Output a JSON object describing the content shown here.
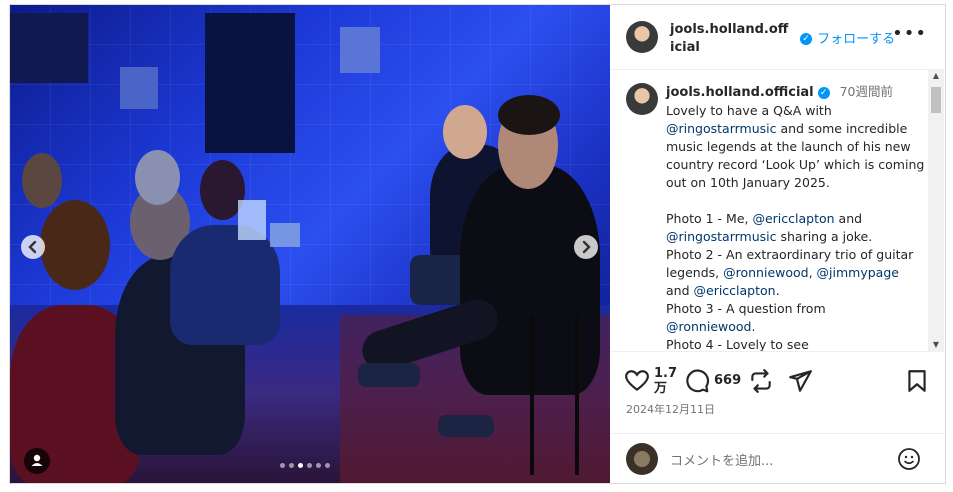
{
  "header": {
    "username": "jools.holland.official",
    "follow_label": "フォローする",
    "more_icon": "more-horizontal-icon"
  },
  "caption": {
    "username": "jools.holland.official",
    "time_ago": "70週間前",
    "line1_a": "Lovely to have a Q&A with",
    "mention_ringo": "@ringostarrmusic",
    "line1_b": " and some incredible music legends at the launch of his new country record ‘Look Up’ which is coming out on 10th January 2025.",
    "p1_a": "Photo 1 - Me, ",
    "p1_mention1": "@ericclapton",
    "p1_b": " and ",
    "p1_mention2": "@ringostarrmusic",
    "p1_c": " sharing a joke.",
    "p2_a": "Photo 2 - An extraordinary trio of guitar legends, ",
    "p2_mention1": "@ronniewood",
    "p2_sep": ", ",
    "p2_mention2": "@jimmypage",
    "p2_b": " and ",
    "p2_mention3": "@ericclapton",
    "p2_c": ".",
    "p3_a": "Photo 3 - A question from ",
    "p3_mention": "@ronniewood",
    "p3_b": ".",
    "p4": "Photo 4 - Lovely to see"
  },
  "actions": {
    "like_count_1": "1.7",
    "like_count_2": "万",
    "comment_count": "669",
    "date": "2024年12月11日",
    "icons": [
      "heart-icon",
      "comment-icon",
      "repost-icon",
      "share-icon",
      "bookmark-icon"
    ]
  },
  "comment": {
    "placeholder": "コメントを追加...",
    "emoji_icon": "emoji-icon"
  },
  "carousel": {
    "slide_count": 6,
    "active_index": 2,
    "prev_icon": "chevron-left-icon",
    "next_icon": "chevron-right-icon",
    "tag_icon": "user-tag-icon"
  },
  "colors": {
    "link_blue": "#0095f6",
    "mention": "#00376b",
    "stage_blue": "#2c4ff0"
  }
}
